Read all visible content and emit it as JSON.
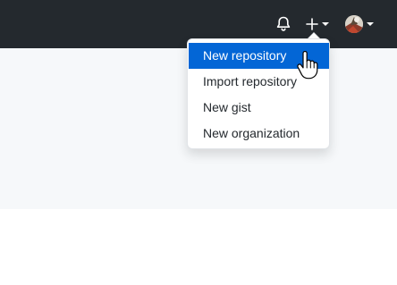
{
  "header": {
    "background_color": "#24292e",
    "icons": {
      "notifications": "bell-icon",
      "create": "plus-icon",
      "create_caret": "caret-down-icon",
      "profile_caret": "caret-down-icon"
    }
  },
  "dropdown": {
    "items": [
      {
        "label": "New repository",
        "active": true
      },
      {
        "label": "Import repository",
        "active": false
      },
      {
        "label": "New gist",
        "active": false
      },
      {
        "label": "New organization",
        "active": false
      }
    ],
    "active_color": "#0366d6"
  },
  "page": {
    "band_color": "#f6f8fa"
  }
}
